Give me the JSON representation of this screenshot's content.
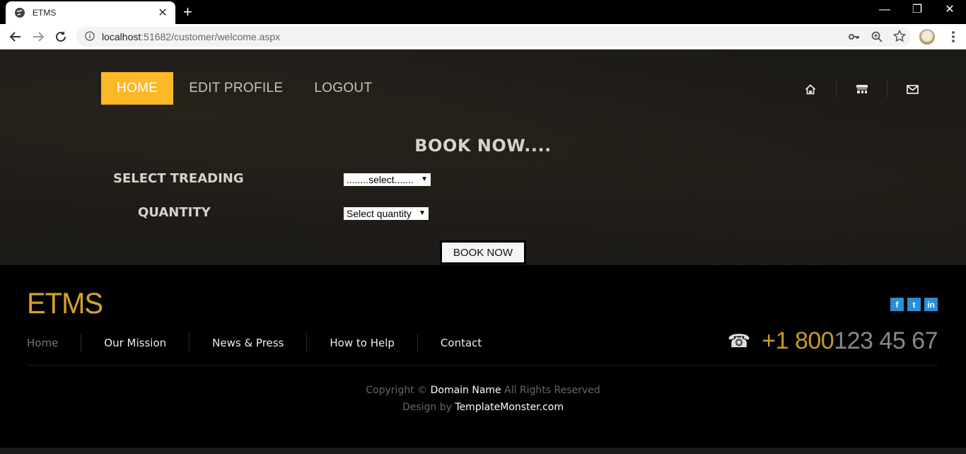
{
  "browser": {
    "tab_title": "ETMS",
    "tab_close": "✕",
    "new_tab": "+",
    "url_host": "localhost",
    "url_rest": ":51682/customer/welcome.aspx",
    "window_controls": {
      "minimize": "—",
      "restore": "❐",
      "close": "✕"
    }
  },
  "nav": {
    "items": [
      {
        "label": "HOME",
        "active": true
      },
      {
        "label": "EDIT PROFILE",
        "active": false
      },
      {
        "label": "LOGOUT",
        "active": false
      }
    ],
    "accent": "#fdb827"
  },
  "top_icons": [
    "home-icon",
    "store-icon",
    "mail-icon"
  ],
  "booking": {
    "title": "BOOK NOW....",
    "treading_label": "SELECT TREADING",
    "treading_value": "........select.......",
    "quantity_label": "QUANTITY",
    "quantity_value": "Select quantity",
    "submit_label": "BOOK NOW"
  },
  "footer": {
    "logo": "ETMS",
    "social": [
      {
        "icon": "facebook-icon",
        "glyph": "f"
      },
      {
        "icon": "twitter-icon",
        "glyph": "t"
      },
      {
        "icon": "linkedin-icon",
        "glyph": "in"
      }
    ],
    "nav": [
      "Home",
      "Our Mission",
      "News & Press",
      "How to Help",
      "Contact"
    ],
    "phone_prefix": "+1 800",
    "phone_rest": "123 45 67",
    "copyright_pre": "Copyright © ",
    "copyright_brand": "Domain Name",
    "copyright_post": " All Rights Reserved",
    "design_pre": "Design by ",
    "design_brand": "TemplateMonster.com",
    "logo_color": "#d4a326"
  }
}
